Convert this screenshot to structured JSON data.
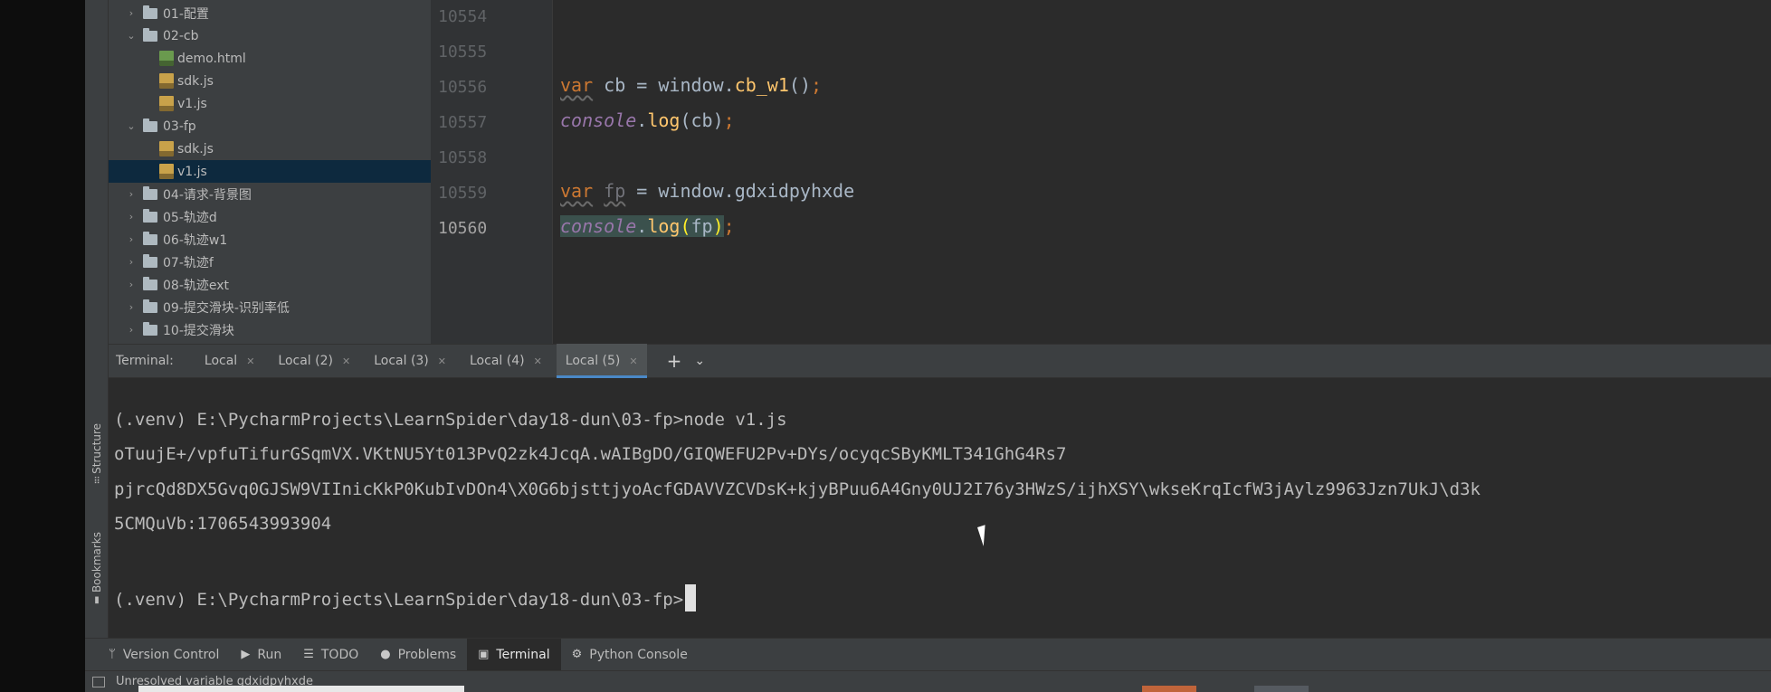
{
  "tool_strip": {
    "structure_label": "Structure",
    "bookmarks_label": "Bookmarks"
  },
  "project_tree": {
    "items": [
      {
        "label": "01-配置",
        "type": "folder",
        "expanded": false,
        "indent": 0
      },
      {
        "label": "02-cb",
        "type": "folder",
        "expanded": true,
        "indent": 0
      },
      {
        "label": "demo.html",
        "type": "html",
        "indent": 1
      },
      {
        "label": "sdk.js",
        "type": "js",
        "indent": 1
      },
      {
        "label": "v1.js",
        "type": "js",
        "indent": 1
      },
      {
        "label": "03-fp",
        "type": "folder",
        "expanded": true,
        "indent": 0
      },
      {
        "label": "sdk.js",
        "type": "js",
        "indent": 1
      },
      {
        "label": "v1.js",
        "type": "js",
        "indent": 1,
        "selected": true
      },
      {
        "label": "04-请求-背景图",
        "type": "folder",
        "expanded": false,
        "indent": 0
      },
      {
        "label": "05-轨迹d",
        "type": "folder",
        "expanded": false,
        "indent": 0
      },
      {
        "label": "06-轨迹w1",
        "type": "folder",
        "expanded": false,
        "indent": 0
      },
      {
        "label": "07-轨迹f",
        "type": "folder",
        "expanded": false,
        "indent": 0
      },
      {
        "label": "08-轨迹ext",
        "type": "folder",
        "expanded": false,
        "indent": 0
      },
      {
        "label": "09-提交滑块-识别率低",
        "type": "folder",
        "expanded": false,
        "indent": 0
      },
      {
        "label": "10-提交滑块",
        "type": "folder",
        "expanded": false,
        "indent": 0
      }
    ]
  },
  "editor": {
    "line_numbers": [
      "10554",
      "10555",
      "10556",
      "10557",
      "10558",
      "10559",
      "10560"
    ],
    "current_line": "10560",
    "code": {
      "l3": {
        "kw": "var",
        "name": " cb ",
        "op": "=",
        "obj": " window",
        "dot": ".",
        "fn": "cb_w1",
        "call": "()",
        "semi": ";"
      },
      "l4": {
        "glob": "console",
        "dot": ".",
        "fn": "log",
        "args": "(cb)",
        "semi": ";"
      },
      "l6": {
        "kw": "var",
        "sp": " ",
        "name": "fp",
        "op": " = ",
        "obj": "window",
        "dot": ".",
        "prop": "gdxidpyhxde"
      },
      "l7": {
        "glob": "console",
        "dot": ".",
        "fn": "log",
        "open": "(",
        "arg": "fp",
        "close": ")",
        "semi": ";"
      }
    }
  },
  "terminal_tabs": {
    "label": "Terminal:",
    "tabs": [
      "Local",
      "Local (2)",
      "Local (3)",
      "Local (4)",
      "Local (5)"
    ],
    "active_index": 4,
    "close_glyph": "✕",
    "add_glyph": "+",
    "menu_glyph": "⌄"
  },
  "terminal": {
    "lines": [
      "(.venv) E:\\PycharmProjects\\LearnSpider\\day18-dun\\03-fp>node v1.js",
      "oTuujE+/vpfuTifurGSqmVX.VKtNU5Yt013PvQ2zk4JcqA.wAIBgDO/GIQWEFU2Pv+DYs/ocyqcSByKMLT341GhG4Rs7",
      "pjrcQd8DX5Gvq0GJSW9VIInicKkP0KubIvDOn4\\X0G6bjsttjyoAcfGDAVVZCVDsK+kjyBPuu6A4Gny0UJ2I76y3HWzS/ijhXSY\\wkseKrqIcfW3jAylz9963Jzn7UkJ\\d3k",
      "5CMQuVb:1706543993904",
      "(.venv) E:\\PycharmProjects\\LearnSpider\\day18-dun\\03-fp>"
    ]
  },
  "bottom_tools": [
    {
      "label": "Version Control",
      "icon": "branch-icon",
      "glyph": "ᛘ"
    },
    {
      "label": "Run",
      "icon": "run-icon",
      "glyph": "▶"
    },
    {
      "label": "TODO",
      "icon": "todo-icon",
      "glyph": "☰"
    },
    {
      "label": "Problems",
      "icon": "problems-icon",
      "glyph": "●"
    },
    {
      "label": "Terminal",
      "icon": "terminal-icon",
      "glyph": "▣",
      "active": true
    },
    {
      "label": "Python Console",
      "icon": "python-console-icon",
      "glyph": "⚙"
    }
  ],
  "status_bar": {
    "message": "Unresolved variable gdxidpyhxde"
  },
  "colors": {
    "keyword": "#cc7832",
    "function": "#ffc66d",
    "global": "#9876aa",
    "selection": "#0d293e",
    "tab_accent": "#4a88c7"
  }
}
